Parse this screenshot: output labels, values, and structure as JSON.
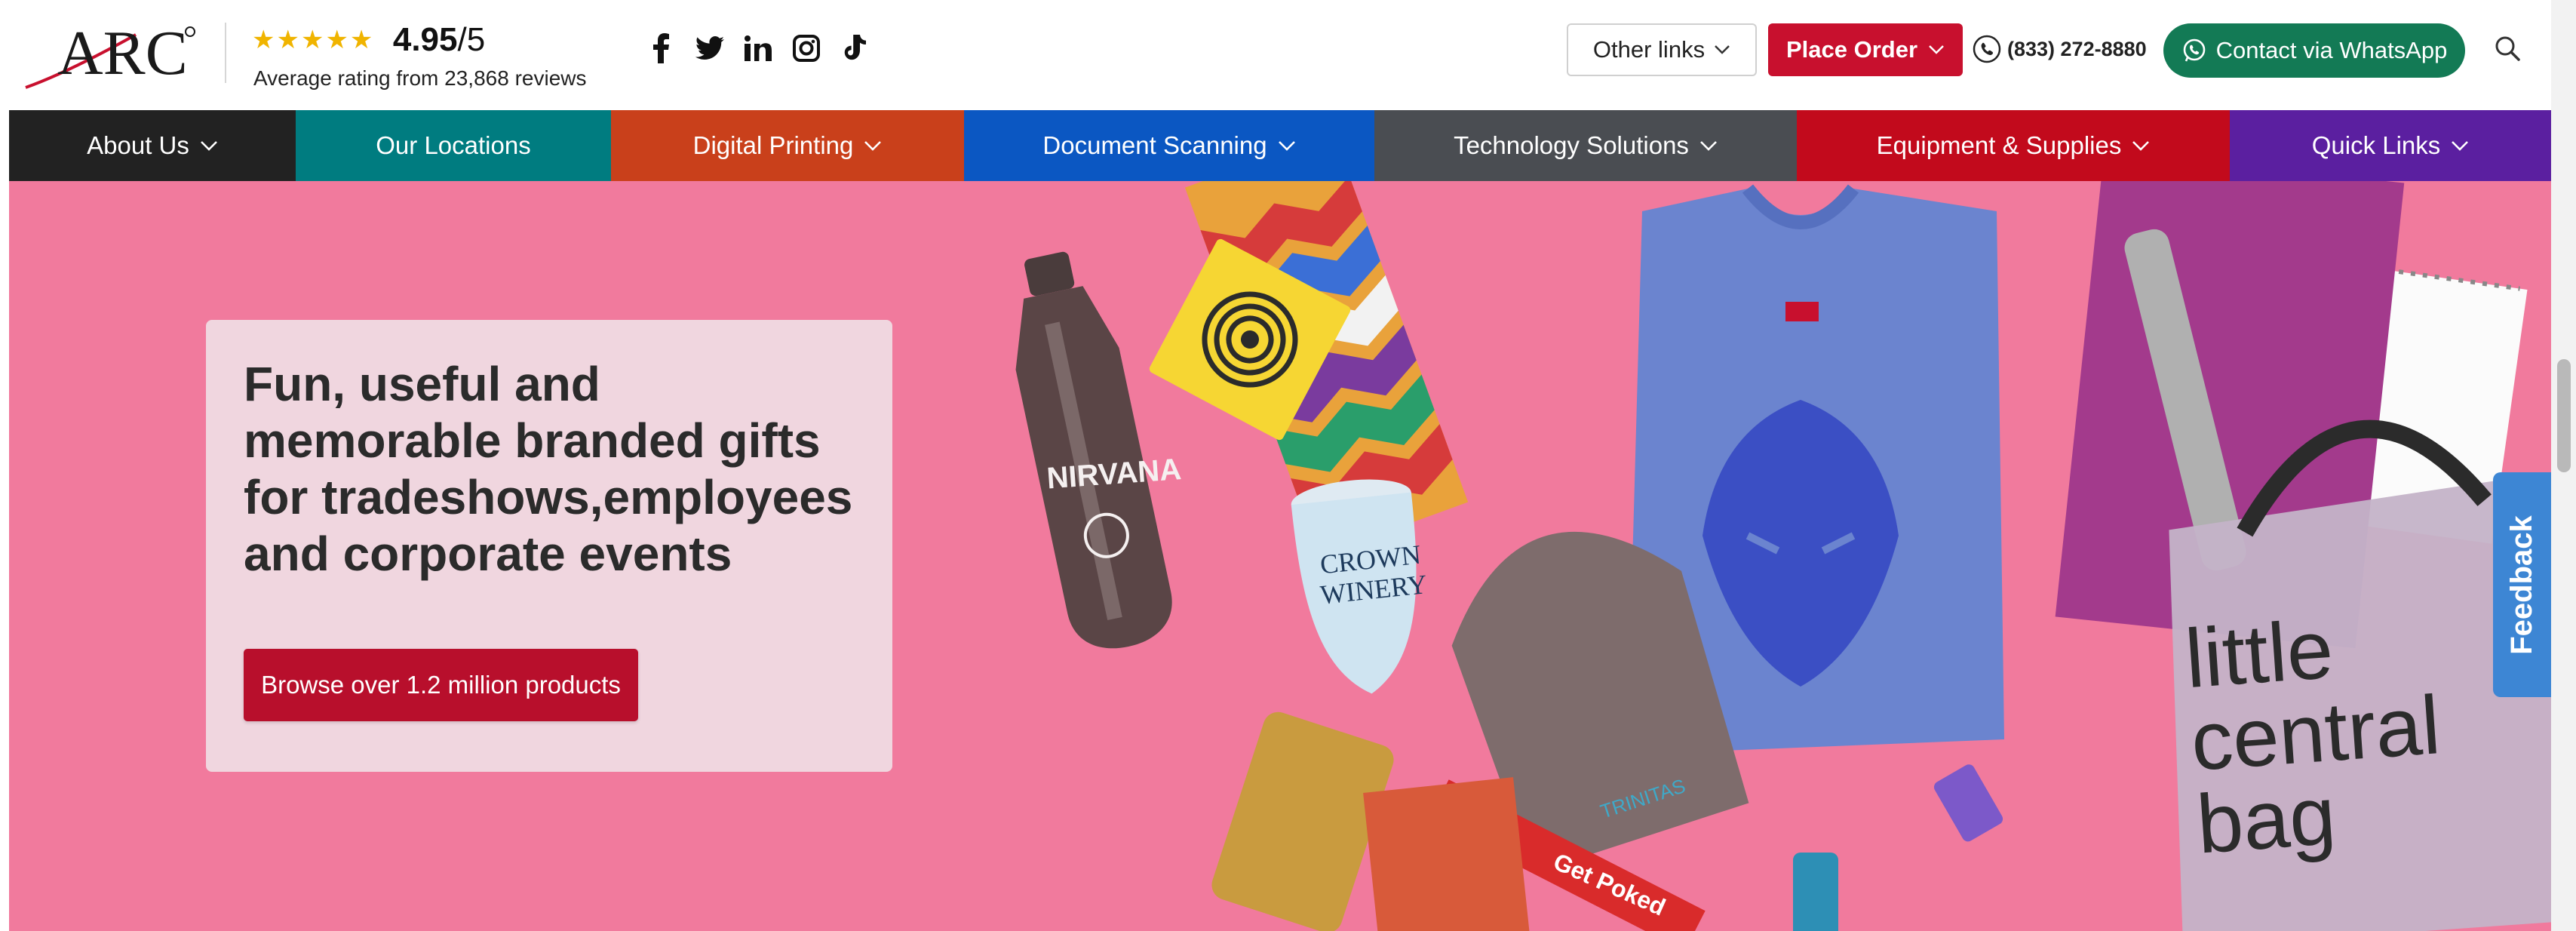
{
  "brand": {
    "logo_text": "ARC"
  },
  "rating": {
    "stars": "★★★★★",
    "score": "4.95",
    "out_of": "/5",
    "subtitle": "Average rating from 23,868 reviews"
  },
  "socials": [
    {
      "icon": "facebook-icon"
    },
    {
      "icon": "twitter-icon"
    },
    {
      "icon": "linkedin-icon"
    },
    {
      "icon": "instagram-icon"
    },
    {
      "icon": "tiktok-icon"
    }
  ],
  "header": {
    "other_links": "Other links",
    "place_order": "Place Order",
    "phone": "(833) 272-8880",
    "whatsapp": "Contact via WhatsApp"
  },
  "nav": {
    "items": [
      {
        "label": "About Us",
        "has_dropdown": true,
        "color": "#222222"
      },
      {
        "label": "Our Locations",
        "has_dropdown": false,
        "color": "#007c80"
      },
      {
        "label": "Digital Printing",
        "has_dropdown": true,
        "color": "#c9401b"
      },
      {
        "label": "Document Scanning",
        "has_dropdown": true,
        "color": "#0b57c2"
      },
      {
        "label": "Technology Solutions",
        "has_dropdown": true,
        "color": "#4a4d52"
      },
      {
        "label": "Equipment & Supplies",
        "has_dropdown": true,
        "color": "#c20a1c"
      },
      {
        "label": "Quick Links",
        "has_dropdown": true,
        "color": "#5b1fa0"
      }
    ]
  },
  "hero": {
    "background": "#f17a9d",
    "title": "Fun, useful and memorable branded gifts for tradeshows,employees and corporate events",
    "cta": "Browse over 1.2 million products",
    "bottle_text": "NIRVANA",
    "tumbler_text_1": "CROWN",
    "tumbler_text_2": "WINERY",
    "bag_text_1": "little",
    "bag_text_2": "central",
    "bag_text_3": "bag",
    "lanyard_text": "Get Poked",
    "beanie_text": "TRINITAS"
  },
  "feedback": "Feedback",
  "colors": {
    "accent_red": "#c8102e",
    "whatsapp_green": "#137a55",
    "feedback_blue": "#3d86d4"
  }
}
